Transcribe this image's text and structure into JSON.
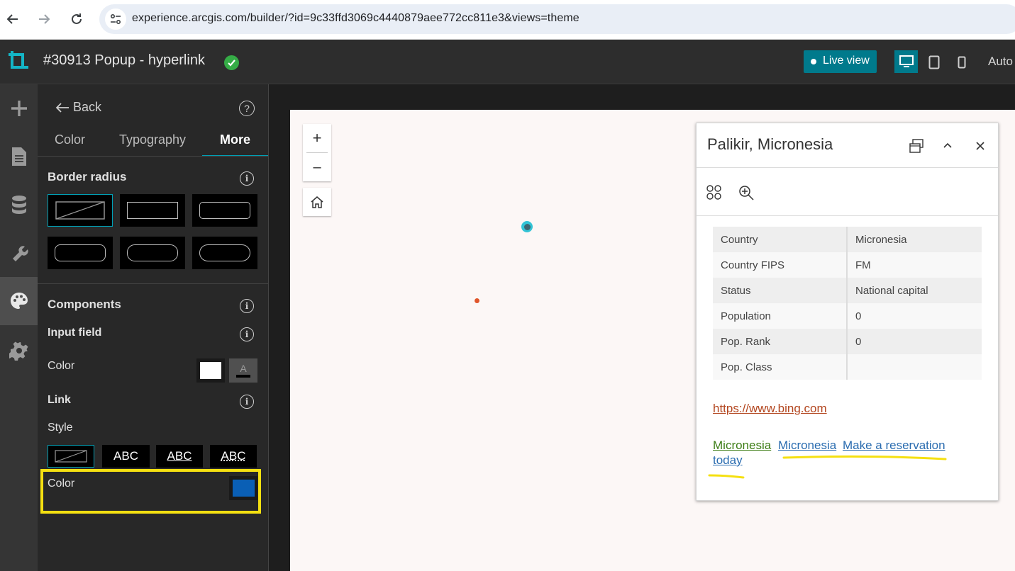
{
  "browser": {
    "url": "experience.arcgis.com/builder/?id=9c33ffd3069c4440879aee772cc811e3&views=theme"
  },
  "header": {
    "title": "#30913 Popup - hyperlink",
    "live_view_label": "Live view",
    "auto_label": "Auto",
    "status_color": "#35ac46"
  },
  "panel": {
    "back_label": "Back",
    "tabs": [
      {
        "label": "Color",
        "active": false
      },
      {
        "label": "Typography",
        "active": false
      },
      {
        "label": "More",
        "active": true
      }
    ],
    "border_radius_heading": "Border radius",
    "components_heading": "Components",
    "input_field_label": "Input field",
    "input_color_label": "Color",
    "input_color_swatch": "#ffffff",
    "input_text_glyph": "A",
    "link_label": "Link",
    "style_label": "Style",
    "style_options": [
      "ABC",
      "ABC",
      "ABC"
    ],
    "link_color_label": "Color",
    "link_color_value": "#0a5fb5",
    "accent": "#00a0b5",
    "highlight_color": "#f5e011"
  },
  "popup": {
    "title": "Palikir, Micronesia",
    "attributes": [
      {
        "field": "Country",
        "value": "Micronesia"
      },
      {
        "field": "Country FIPS",
        "value": "FM"
      },
      {
        "field": "Status",
        "value": "National capital"
      },
      {
        "field": "Population",
        "value": "0"
      },
      {
        "field": "Pop. Rank",
        "value": "0"
      },
      {
        "field": "Pop. Class",
        "value": ""
      }
    ],
    "url_link": "https://www.bing.com",
    "link_green": "Micronesia",
    "link_blue": "Micronesia",
    "link_reservation_1": "Make a reservation",
    "link_reservation_2": "today",
    "colors": {
      "url_link": "#b3461f",
      "green_link": "#3d7d16",
      "blue_link": "#2a6cb0"
    }
  },
  "map": {
    "zoom_in": "+",
    "zoom_out": "–",
    "selected_marker_color": "#33c4d6",
    "marker_color": "#e0552a"
  }
}
